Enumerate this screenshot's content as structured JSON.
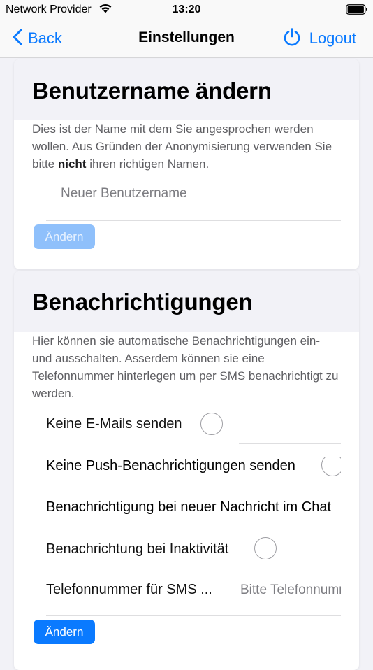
{
  "status_bar": {
    "carrier": "Network Provider",
    "time": "13:20"
  },
  "nav": {
    "back_label": "Back",
    "title": "Einstellungen",
    "logout_label": "Logout",
    "accent_color": "#0a7aff"
  },
  "username_card": {
    "title": "Benutzername ändern",
    "desc_part1": "Dies ist der Name mit dem Sie angesprochen werden wollen. Aus Gründen der Anonymisierung verwenden Sie bitte ",
    "desc_bold": "nicht",
    "desc_part2": " ihren richtigen Namen.",
    "input_placeholder": "Neuer Benutzername",
    "button_label": "Ändern"
  },
  "notifications_card": {
    "title": "Benachrichtigungen",
    "description": "Hier können sie automatische Benachrichtigungen ein- und ausschalten. Asserdem können sie eine Telefonnummer hinterlegen um per SMS benachrichtigt zu werden.",
    "options": [
      {
        "label": "Keine E-Mails senden"
      },
      {
        "label": "Keine Push-Benachrichtigungen senden"
      },
      {
        "label": "Benachrichtigung bei neuer Nachricht im Chat"
      },
      {
        "label": "Benachrichtung bei Inaktivität"
      }
    ],
    "phone_label": "Telefonnummer für SMS ...",
    "phone_placeholder": "Bitte Telefonnummer eingeben",
    "button_label": "Ändern"
  }
}
